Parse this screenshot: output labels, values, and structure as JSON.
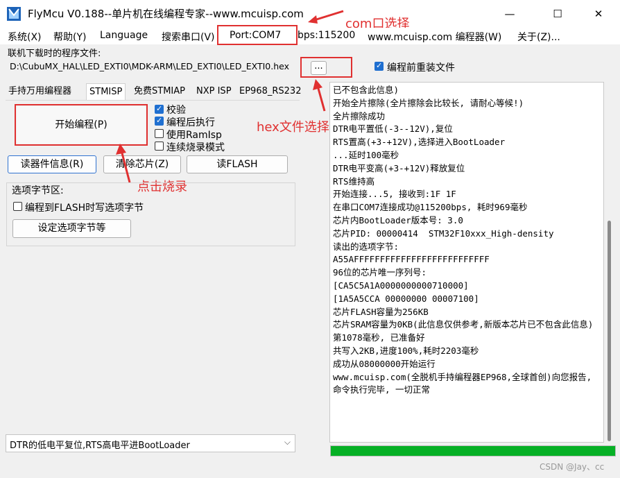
{
  "window": {
    "title": "FlyMcu V0.188--单片机在线编程专家--www.mcuisp.com",
    "min": "—",
    "max": "☐",
    "close": "✕"
  },
  "menu": [
    "系统(X)",
    "帮助(Y)",
    "Language",
    "搜索串口(V)",
    "Port:COM7",
    "bps:115200",
    "www.mcuisp.com 编程器(W)",
    "关于(Z)..."
  ],
  "file": {
    "label": "联机下载时的程序文件:",
    "path": "D:\\CubuMX_HAL\\LED_EXTI0\\MDK-ARM\\LED_EXTI0\\LED_EXTI0.hex",
    "browse": "...",
    "reload_label": "编程前重装文件",
    "reload_checked": true
  },
  "tabs": [
    "手持万用编程器",
    "STMISP",
    "免费STMIAP",
    "NXP ISP",
    "EP968_RS232"
  ],
  "stmisp": {
    "start_button": "开始编程(P)",
    "verify": "校验",
    "run_after": "编程后执行",
    "use_ramisp": "使用RamIsp",
    "continuous": "连续烧录模式",
    "read_info": "读器件信息(R)",
    "erase": "清除芯片(Z)",
    "read_flash": "读FLASH",
    "option_group": "选项字节区:",
    "write_option": "编程到FLASH时写选项字节",
    "set_option": "设定选项字节等"
  },
  "bottom_select": "DTR的低电平复位,RTS高电平进BootLoader",
  "annotations": {
    "com": "com口选择",
    "hex": "hex文件选择",
    "click": "点击烧录"
  },
  "log": [
    "已不包含此信息)",
    "开始全片擦除(全片擦除会比较长, 请耐心等候!)",
    "全片擦除成功",
    "DTR电平置低(-3--12V),复位",
    "RTS置高(+3-+12V),选择进入BootLoader",
    "...延时100毫秒",
    "DTR电平变高(+3-+12V)释放复位",
    "RTS维持高",
    "开始连接...5, 接收到:1F 1F",
    "在串口COM7连接成功@115200bps, 耗时969毫秒",
    "芯片内BootLoader版本号: 3.0",
    "芯片PID: 00000414  STM32F10xxx_High-density",
    "读出的选项字节:",
    "A55AFFFFFFFFFFFFFFFFFFFFFFFFFF",
    "96位的芯片唯一序列号:",
    "[CA5C5A1A0000000000710000]",
    "[1A5A5CCA 00000000 00007100]",
    "芯片FLASH容量为256KB",
    "芯片SRAM容量为0KB(此信息仅供参考,新版本芯片已不包含此信息)",
    "第1078毫秒, 已准备好",
    "共写入2KB,进度100%,耗时2203毫秒",
    "成功从08000000开始运行",
    "www.mcuisp.com(全脱机手持编程器EP968,全球首创)向您报告, 命令执行完毕, 一切正常"
  ],
  "progress": 1.0,
  "watermark": "CSDN @Jay、cc",
  "colors": {
    "accent": "#1f6fd0",
    "annotation": "#e03030",
    "progress": "#06b025"
  }
}
